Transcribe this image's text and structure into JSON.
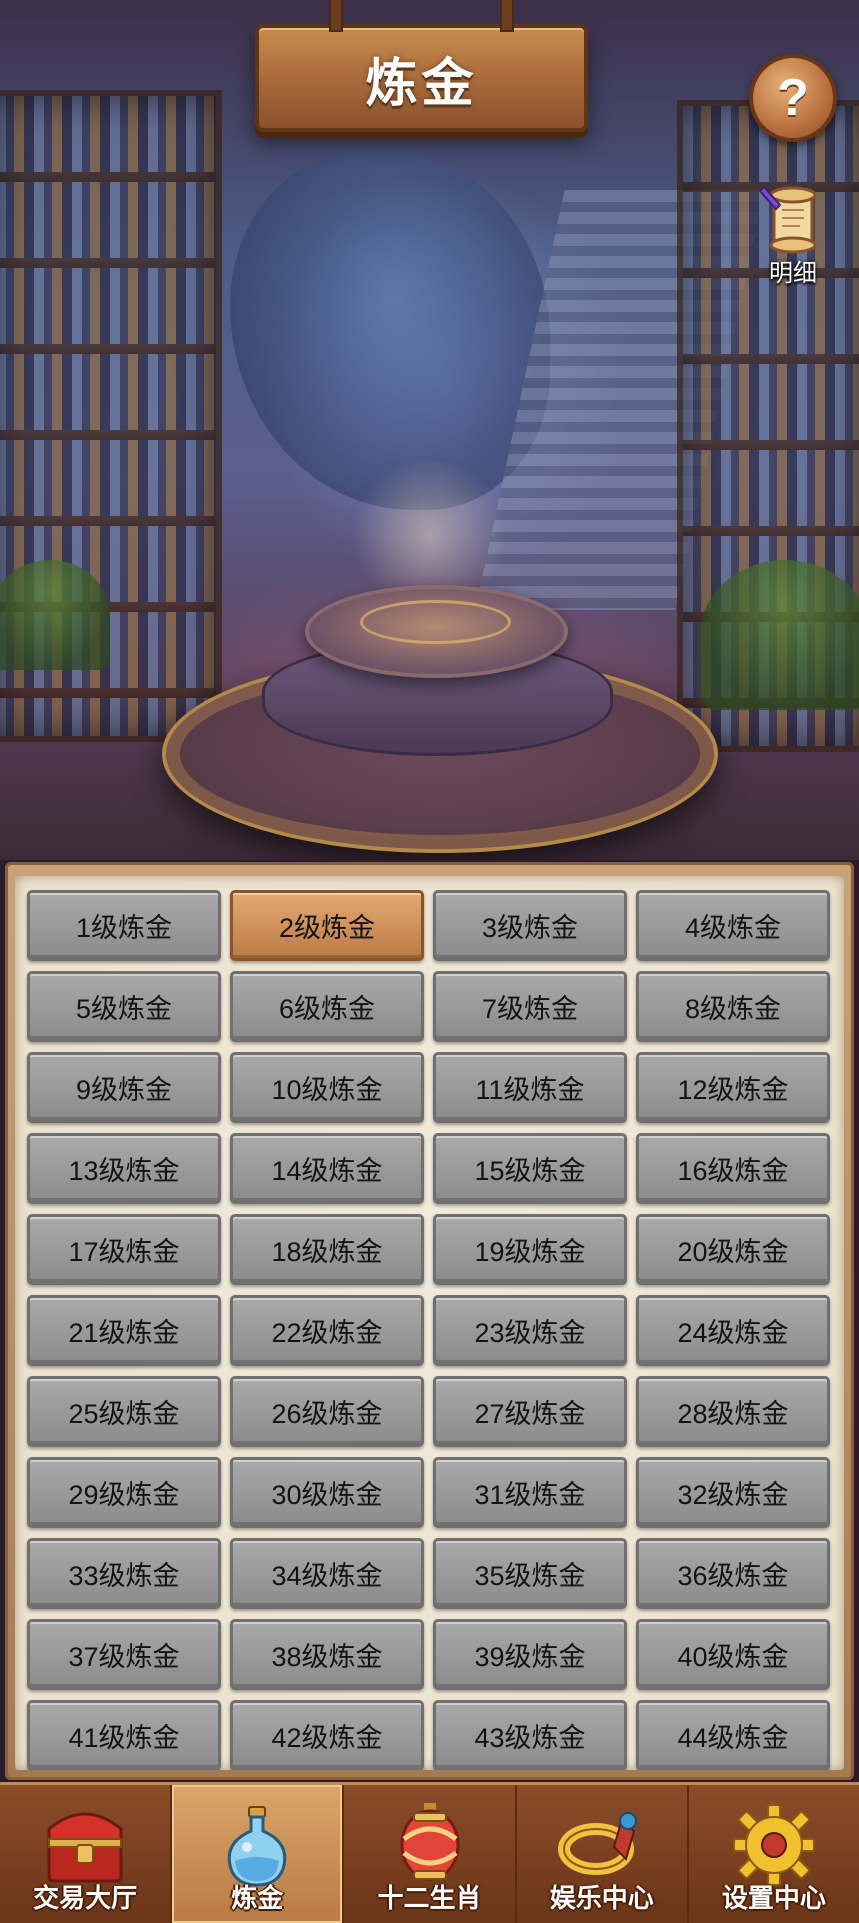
{
  "header": {
    "title": "炼金",
    "help_icon": "question-mark-icon",
    "help_glyph": "?",
    "detail_icon": "scroll-icon",
    "detail_label": "明细"
  },
  "levels": {
    "selected": "2级炼金",
    "items": [
      "1级炼金",
      "2级炼金",
      "3级炼金",
      "4级炼金",
      "5级炼金",
      "6级炼金",
      "7级炼金",
      "8级炼金",
      "9级炼金",
      "10级炼金",
      "11级炼金",
      "12级炼金",
      "13级炼金",
      "14级炼金",
      "15级炼金",
      "16级炼金",
      "17级炼金",
      "18级炼金",
      "19级炼金",
      "20级炼金",
      "21级炼金",
      "22级炼金",
      "23级炼金",
      "24级炼金",
      "25级炼金",
      "26级炼金",
      "27级炼金",
      "28级炼金",
      "29级炼金",
      "30级炼金",
      "31级炼金",
      "32级炼金",
      "33级炼金",
      "34级炼金",
      "35级炼金",
      "36级炼金",
      "37级炼金",
      "38级炼金",
      "39级炼金",
      "40级炼金",
      "41级炼金",
      "42级炼金",
      "43级炼金",
      "44级炼金"
    ]
  },
  "nav": {
    "active": "炼金",
    "items": [
      {
        "label": "交易大厅",
        "icon": "treasure-chest-icon"
      },
      {
        "label": "炼金",
        "icon": "potion-bottle-icon"
      },
      {
        "label": "十二生肖",
        "icon": "lantern-icon"
      },
      {
        "label": "娱乐中心",
        "icon": "ring-icon"
      },
      {
        "label": "设置中心",
        "icon": "gear-icon"
      }
    ]
  },
  "colors": {
    "accent_selected": "#cf8f5a",
    "level_button": "#9a9a9a",
    "nav_bg": "#6b3518",
    "title_plank": "#a8693a"
  }
}
